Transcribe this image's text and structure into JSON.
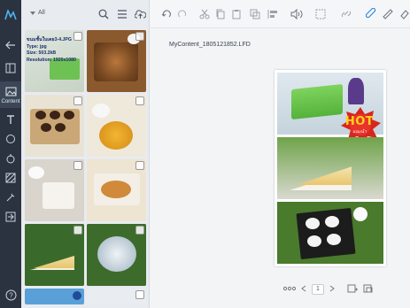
{
  "media_panel": {
    "filter_label": "All",
    "selected_file": {
      "name": "ขนมชั้นใบเตย3-4.JPG",
      "type": "Type: jpg",
      "size": "Size: 503.2kB",
      "resolution": "Resolution: 1920x1080"
    },
    "tiles": [
      {
        "label": "pandan-layer-cake"
      },
      {
        "label": "nut-cookies"
      },
      {
        "label": "chocolate-cookies"
      },
      {
        "label": "golden-dessert"
      },
      {
        "label": "coffee-cup"
      },
      {
        "label": "croissant"
      },
      {
        "label": "steamed-coconut-cakes"
      },
      {
        "label": "cake-slice"
      },
      {
        "label": "jelly-dessert"
      },
      {
        "label": "video-tile"
      },
      {
        "label": "dessert-tile"
      }
    ]
  },
  "rail": {
    "active_label": "Content"
  },
  "canvas": {
    "filename": "MyContent_1805121852.LFD",
    "hot_text": "HOT",
    "hot_subtext": "แนะนำ"
  },
  "pager": {
    "current_page": "1"
  },
  "colors": {
    "rail": "#2b3340",
    "accent": "#2a8be0",
    "hot_red": "#d7261e"
  }
}
